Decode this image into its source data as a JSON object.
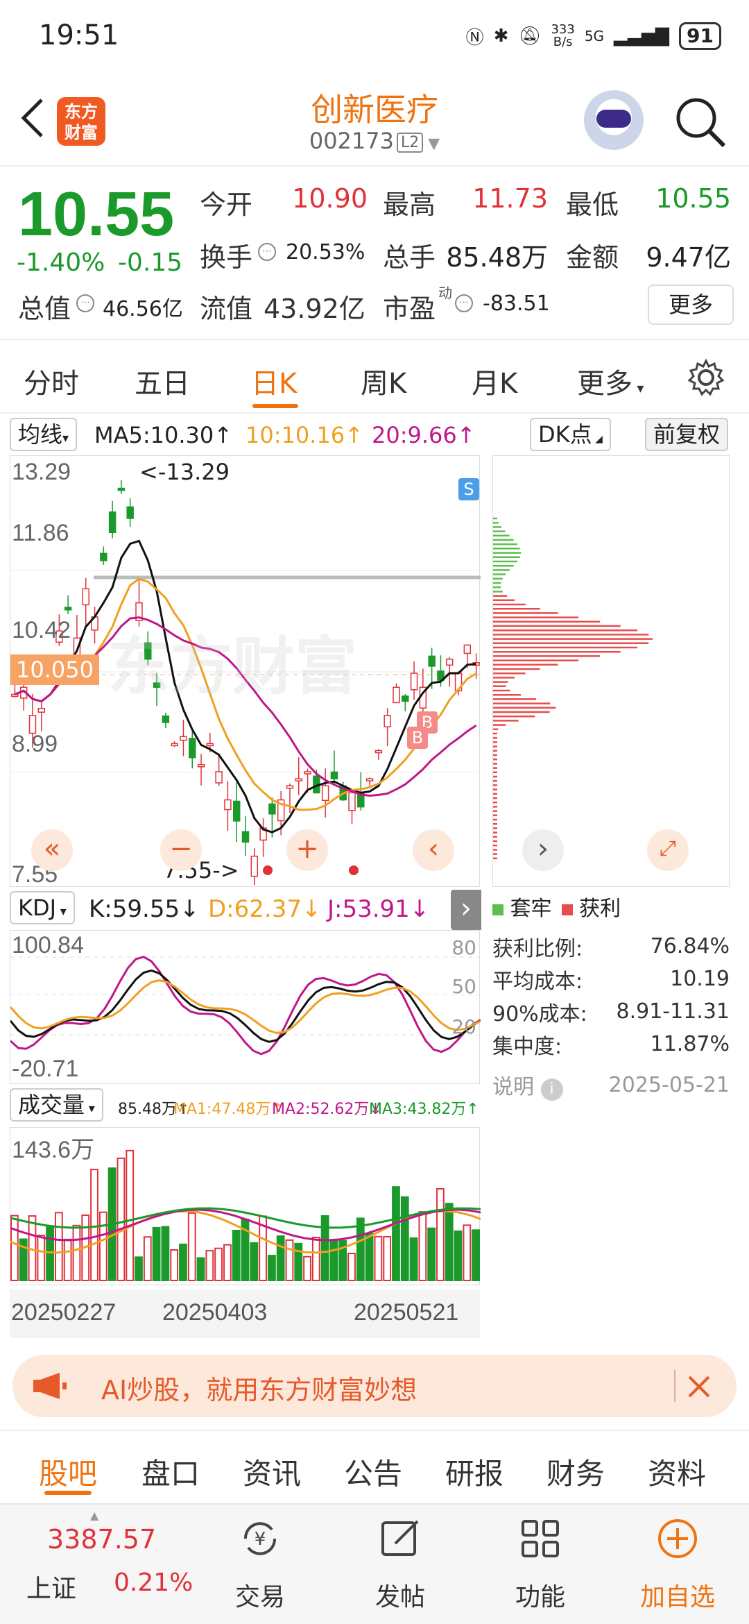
{
  "status": {
    "time": "19:51",
    "net_speed": "333\nB/s",
    "net_type": "5G",
    "battery": "91"
  },
  "header": {
    "logo_text": "东方\n财富",
    "stock_name": "创新医疗",
    "stock_code": "002173",
    "level": "L2"
  },
  "quote": {
    "price": "10.55",
    "change_pct": "-1.40%",
    "change": "-0.15",
    "open_label": "今开",
    "open": "10.90",
    "high_label": "最高",
    "high": "11.73",
    "low_label": "最低",
    "low": "10.55",
    "turnover_label": "换手",
    "turnover": "20.53%",
    "volume_label": "总手",
    "volume": "85.48万",
    "amount_label": "金额",
    "amount": "9.47亿",
    "mcap_label": "总值",
    "mcap": "46.56亿",
    "float_label": "流值",
    "float": "43.92亿",
    "pe_label": "市盈",
    "pe_sup": "动",
    "pe": "-83.51",
    "more": "更多"
  },
  "period_tabs": [
    {
      "label": "分时",
      "active": false
    },
    {
      "label": "五日",
      "active": false
    },
    {
      "label": "日K",
      "active": true
    },
    {
      "label": "周K",
      "active": false
    },
    {
      "label": "月K",
      "active": false
    },
    {
      "label": "更多",
      "active": false
    }
  ],
  "chart_bar": {
    "ma_select": "均线",
    "ma5": "MA5:10.30↑",
    "ma10": "10:10.16↑",
    "ma20": "20:9.66↑",
    "dk": "DK点",
    "adjust": "前复权"
  },
  "kchart": {
    "y_labels": [
      "13.29",
      "11.86",
      "10.42",
      "8.99",
      "7.55"
    ],
    "current_tag": "10.050",
    "high_note": "<-13.29",
    "low_note": "7.55->",
    "markers": {
      "s": "S",
      "b": "B"
    },
    "watermark": "东方财富",
    "colors": {
      "up": "#e0323a",
      "down": "#1a9a2a",
      "ma5": "#111111",
      "ma10": "#f0a020",
      "ma20": "#c0168c"
    }
  },
  "kdj": {
    "select": "KDJ",
    "k": "K:59.55↓",
    "d": "D:62.37↓",
    "j": "J:53.91↓",
    "y_top": "100.84",
    "y_bottom": "-20.71",
    "levels": [
      "80",
      "50",
      "20"
    ]
  },
  "volume": {
    "select": "成交量",
    "vol": "85.48万↑",
    "ma1": "MA1:47.48万↑",
    "ma2": "MA2:52.62万↓",
    "ma3": "MA3:43.82万↑",
    "y_top": "143.6万"
  },
  "dates": [
    "20250227",
    "20250403",
    "20250521"
  ],
  "chip": {
    "legend_loss": "套牢",
    "legend_profit": "获利",
    "rows": [
      {
        "label": "获利比例:",
        "value": "76.84%"
      },
      {
        "label": "平均成本:",
        "value": "10.19"
      },
      {
        "label": "90%成本:",
        "value": "8.91-11.31"
      },
      {
        "label": "集中度:",
        "value": "11.87%"
      }
    ],
    "note": "说明",
    "date": "2025-05-21"
  },
  "banner": {
    "text": "AI炒股，就用东方财富妙想"
  },
  "info_tabs": [
    {
      "label": "股吧",
      "active": true
    },
    {
      "label": "盘口",
      "active": false
    },
    {
      "label": "资讯",
      "active": false
    },
    {
      "label": "公告",
      "active": false
    },
    {
      "label": "研报",
      "active": false
    },
    {
      "label": "财务",
      "active": false
    },
    {
      "label": "资料",
      "active": false
    }
  ],
  "bottom_nav": {
    "index_value": "3387.57",
    "index_name": "上证",
    "index_change": "0.21%",
    "items": [
      {
        "label": "交易"
      },
      {
        "label": "发帖"
      },
      {
        "label": "功能"
      },
      {
        "label": "加自选"
      }
    ]
  }
}
